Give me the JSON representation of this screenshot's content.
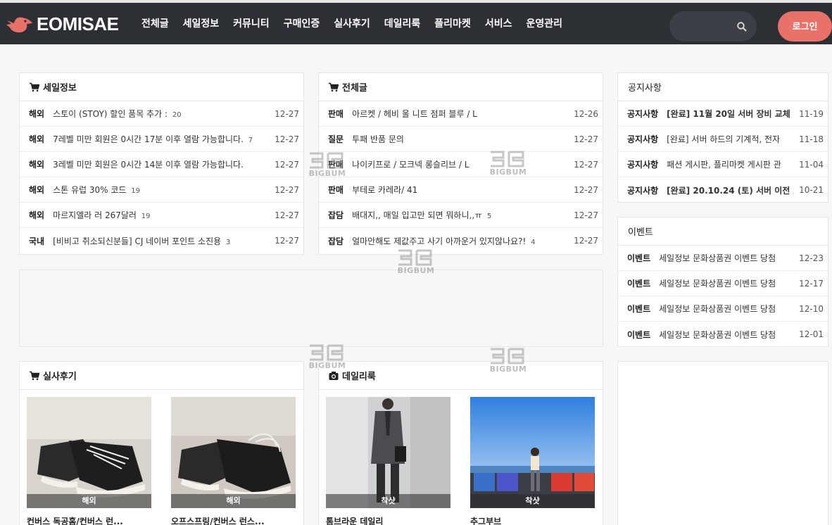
{
  "header": {
    "logo_text": "EOMISAE",
    "nav": [
      "전체글",
      "세일정보",
      "커뮤니티",
      "구매인증",
      "실사후기",
      "데일리룩",
      "플리마켓",
      "서비스",
      "운영관리"
    ],
    "search_placeholder": "",
    "login_label": "로그인",
    "accent_color": "#e8726a"
  },
  "sale_info": {
    "title": "세일정보",
    "icon": "cart-icon",
    "rows": [
      {
        "cat": "해외",
        "title": "스토이 (STOY) 할인 품목 추가 :",
        "count": "20",
        "date": "12-27"
      },
      {
        "cat": "해외",
        "title": "7레벨 미만 회원은 0시간 17분 이후 열람 가능합니다.",
        "count": "7",
        "date": "12-27"
      },
      {
        "cat": "해외",
        "title": "3레벨 미만 회원은 0시간 14분 이후 열람 가능합니다.",
        "count": "",
        "date": "12-27"
      },
      {
        "cat": "해외",
        "title": "스톤 유럽 30% 코드",
        "count": "19",
        "date": "12-27"
      },
      {
        "cat": "해외",
        "title": "마르지엘라 러 267달러",
        "count": "19",
        "date": "12-27"
      },
      {
        "cat": "국내",
        "title": "[비비고 취소되신분들] CJ 네이버 포인트 소진용",
        "count": "3",
        "date": "12-27"
      }
    ]
  },
  "all_posts": {
    "title": "전체글",
    "icon": "cart-icon",
    "rows": [
      {
        "cat": "판매",
        "title": "아르켓 / 헤비 울 니트 점퍼 블루 / L",
        "count": "",
        "date": "12-26"
      },
      {
        "cat": "질문",
        "title": "투패 반품 문의",
        "count": "",
        "date": "12-27"
      },
      {
        "cat": "판매",
        "title": "나이키프로 / 모크넥 롱슬리브 / L",
        "count": "",
        "date": "12-27"
      },
      {
        "cat": "판매",
        "title": "부테로 카레라/ 41",
        "count": "",
        "date": "12-27"
      },
      {
        "cat": "잡담",
        "title": "배대지,, 매일 입고만 되면 뭐하니,,ㅠ",
        "count": "5",
        "date": "12-27"
      },
      {
        "cat": "잡담",
        "title": "얼마안해도 제값주고 사기 아까운거 있지않나요?!",
        "count": "4",
        "date": "12-27"
      }
    ]
  },
  "notice": {
    "title": "공지사항",
    "rows": [
      {
        "cat": "공지사항",
        "title": "[완료] 11월 20일 서버 장비 교체",
        "bold": true,
        "date": "11-19"
      },
      {
        "cat": "공지사항",
        "title": "[완료] 서버 하드의 기계적, 전자",
        "bold": false,
        "date": "11-18"
      },
      {
        "cat": "공지사항",
        "title": "패션 게시판, 플리마켓 게시판 관",
        "bold": false,
        "date": "11-04"
      },
      {
        "cat": "공지사항",
        "title": "[완료] 20.10.24 (토) 서버 이전",
        "bold": true,
        "date": "10-21"
      }
    ]
  },
  "events": {
    "title": "이벤트",
    "rows": [
      {
        "cat": "이벤트",
        "title": "세일정보 문화상품권 이벤트 당첨",
        "date": "12-23"
      },
      {
        "cat": "이벤트",
        "title": "세일정보 문화상품권 이벤트 당첨",
        "date": "12-17"
      },
      {
        "cat": "이벤트",
        "title": "세일정보 문화상품권 이벤트 당첨",
        "date": "12-10"
      },
      {
        "cat": "이벤트",
        "title": "세일정보 문화상품권 이벤트 당첨",
        "date": "12-01"
      }
    ]
  },
  "reviews": {
    "title": "실사후기",
    "icon": "cart-icon",
    "items": [
      {
        "tag": "해외",
        "caption": "컨버스 독공홈/컨버스 런...",
        "image": "sneaker-photo"
      },
      {
        "tag": "해외",
        "caption": "오프스프링/컨버스 런스...",
        "image": "sneaker-photo"
      }
    ]
  },
  "dailylook": {
    "title": "데일리룩",
    "icon": "camera-icon",
    "items": [
      {
        "tag": "착샷",
        "caption": "톰브라운 데일리",
        "image": "suit-photo"
      },
      {
        "tag": "착샷",
        "caption": "추그부브",
        "image": "beach-photo"
      }
    ]
  },
  "watermark_text": "BIGBUM"
}
